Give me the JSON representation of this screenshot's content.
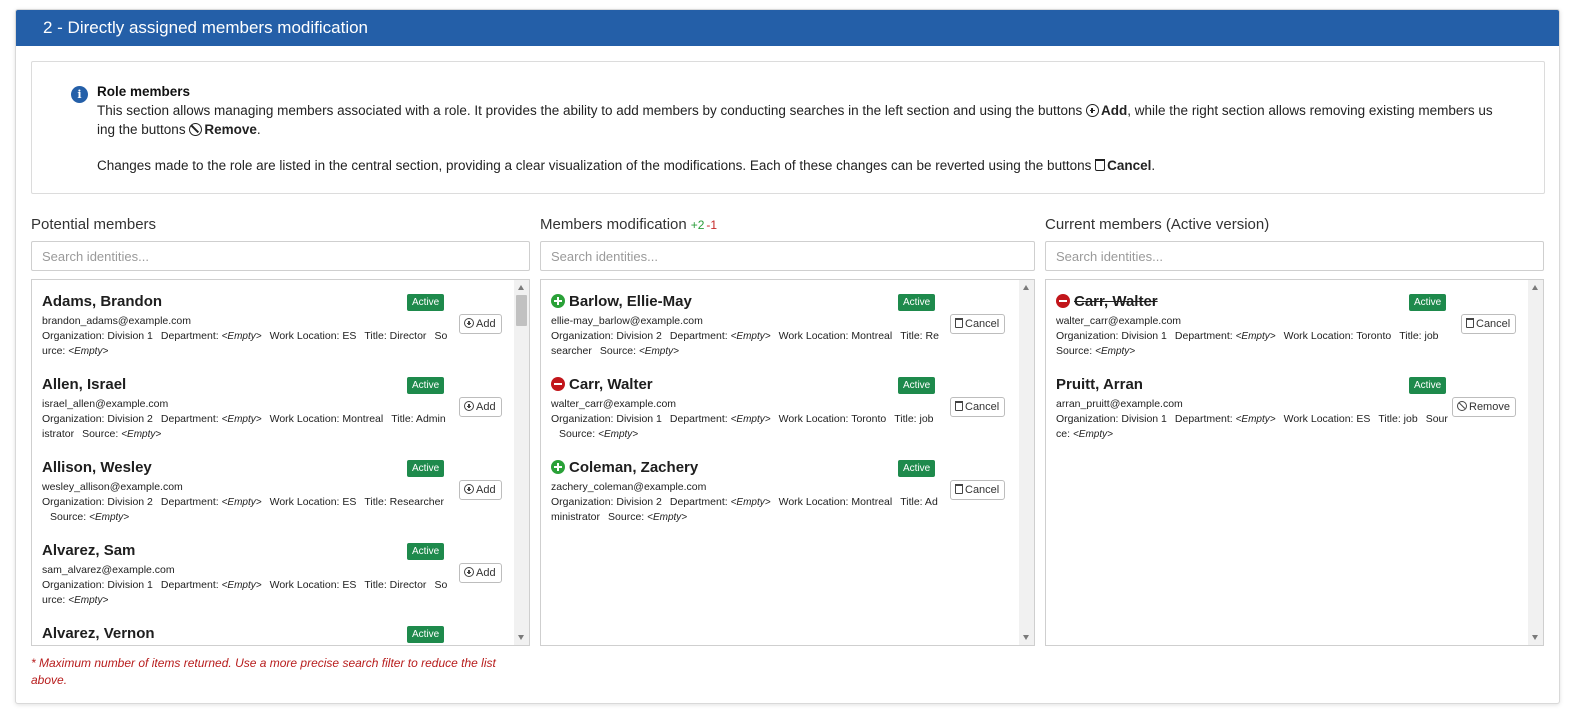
{
  "header": {
    "title": "2 - Directly assigned members modification"
  },
  "info": {
    "title": "Role members",
    "p1_a": "This section allows managing members associated with a role. It provides the ability to add members by conducting searches in the left section and using the buttons ",
    "p1_add": "Add",
    "p1_b": ", while the right section allows removing existing members us ing the buttons ",
    "p1_remove": "Remove",
    "p1_c": ".",
    "p2_a": "Changes made to the role are listed in the central section, providing a clear visualization of the modifications. Each of these changes can be reverted using the buttons ",
    "p2_cancel": "Cancel",
    "p2_b": "."
  },
  "potential": {
    "title": "Potential members",
    "search_placeholder": "Search identities...",
    "items": [
      {
        "name": "Adams, Brandon",
        "status": "Active",
        "email": "brandon_adams@example.com",
        "org": "Organization: Division 1",
        "dept_label": "Department:",
        "dept": "<Empty>",
        "loc": "Work Location: ES",
        "title": "Title: Director",
        "src_label": "Source:",
        "src": "<Empty>",
        "button": "Add"
      },
      {
        "name": "Allen, Israel",
        "status": "Active",
        "email": "israel_allen@example.com",
        "org": "Organization: Division 2",
        "dept_label": "Department:",
        "dept": "<Empty>",
        "loc": "Work Location: Montreal",
        "title": "Title: Administrator",
        "src_label": "Source:",
        "src": "<Empty>",
        "button": "Add"
      },
      {
        "name": "Allison, Wesley",
        "status": "Active",
        "email": "wesley_allison@example.com",
        "org": "Organization: Division 2",
        "dept_label": "Department:",
        "dept": "<Empty>",
        "loc": "Work Location: ES",
        "title": "Title: Researcher",
        "src_label": "Source:",
        "src": "<Empty>",
        "button": "Add"
      },
      {
        "name": "Alvarez, Sam",
        "status": "Active",
        "email": "sam_alvarez@example.com",
        "org": "Organization: Division 1",
        "dept_label": "Department:",
        "dept": "<Empty>",
        "loc": "Work Location: ES",
        "title": "Title: Director",
        "src_label": "Source:",
        "src": "<Empty>",
        "button": "Add"
      },
      {
        "name": "Alvarez, Vernon",
        "status": "Active",
        "email": "",
        "org": "",
        "dept_label": "",
        "dept": "",
        "loc": "",
        "title": "",
        "src_label": "",
        "src": "",
        "button": ""
      }
    ]
  },
  "modification": {
    "title": "Members modification",
    "added_count": "+2",
    "removed_count": "-1",
    "search_placeholder": "Search identities...",
    "items": [
      {
        "name": "Barlow, Ellie-May",
        "change": "add",
        "status": "Active",
        "email": "ellie-may_barlow@example.com",
        "org": "Organization: Division 2",
        "dept_label": "Department:",
        "dept": "<Empty>",
        "loc": "Work Location: Montreal",
        "title": "Title: Researcher",
        "src_label": "Source:",
        "src": "<Empty>",
        "button": "Cancel"
      },
      {
        "name": "Carr, Walter",
        "change": "remove",
        "status": "Active",
        "email": "walter_carr@example.com",
        "org": "Organization: Division 1",
        "dept_label": "Department:",
        "dept": "<Empty>",
        "loc": "Work Location: Toronto",
        "title": "Title: job",
        "src_label": "Source:",
        "src": "<Empty>",
        "button": "Cancel"
      },
      {
        "name": "Coleman, Zachery",
        "change": "add",
        "status": "Active",
        "email": "zachery_coleman@example.com",
        "org": "Organization: Division 2",
        "dept_label": "Department:",
        "dept": "<Empty>",
        "loc": "Work Location: Montreal",
        "title": "Title: Administrator",
        "src_label": "Source:",
        "src": "<Empty>",
        "button": "Cancel"
      }
    ]
  },
  "current": {
    "title": "Current members (Active version)",
    "search_placeholder": "Search identities...",
    "items": [
      {
        "name": "Carr, Walter",
        "change": "remove",
        "status": "Active",
        "email": "walter_carr@example.com",
        "org": "Organization: Division 1",
        "dept_label": "Department:",
        "dept": "<Empty>",
        "loc": "Work Location: Toronto",
        "title": "Title: job",
        "src_label": "Source:",
        "src": "<Empty>",
        "button": "Cancel"
      },
      {
        "name": "Pruitt, Arran",
        "change": "",
        "status": "Active",
        "email": "arran_pruitt@example.com",
        "org": "Organization: Division 1",
        "dept_label": "Department:",
        "dept": "<Empty>",
        "loc": "Work Location: ES",
        "title": "Title: job",
        "src_label": "Source:",
        "src": "<Empty>",
        "button": "Remove"
      }
    ]
  },
  "footnote": "* Maximum number of items returned. Use a more precise search filter to reduce the list above.",
  "colors": {
    "header": "#245fa8",
    "badge": "#1e8a4c",
    "added": "#2aa138",
    "removed": "#c2161b",
    "footnote": "#b71c1c"
  }
}
